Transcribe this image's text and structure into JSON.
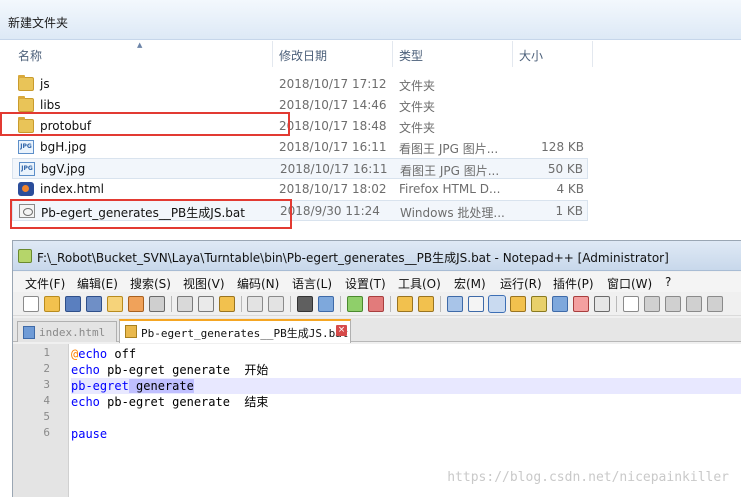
{
  "explorer": {
    "title": "新建文件夹",
    "columns": {
      "name": "名称",
      "date": "修改日期",
      "type": "类型",
      "size": "大小"
    },
    "rows": [
      {
        "name": "js",
        "date": "2018/10/17 17:12",
        "type": "文件夹",
        "size": "",
        "icon": "folder-icon"
      },
      {
        "name": "libs",
        "date": "2018/10/17 14:46",
        "type": "文件夹",
        "size": "",
        "icon": "folder-icon"
      },
      {
        "name": "protobuf",
        "date": "2018/10/17 18:48",
        "type": "文件夹",
        "size": "",
        "icon": "folder-icon"
      },
      {
        "name": "bgH.jpg",
        "date": "2018/10/17 16:11",
        "type": "看图王 JPG 图片...",
        "size": "128 KB",
        "icon": "jpg-file-icon"
      },
      {
        "name": "bgV.jpg",
        "date": "2018/10/17 16:11",
        "type": "看图王 JPG 图片...",
        "size": "50 KB",
        "icon": "jpg-file-icon"
      },
      {
        "name": "index.html",
        "date": "2018/10/17 18:02",
        "type": "Firefox HTML D...",
        "size": "4 KB",
        "icon": "html-file-icon"
      },
      {
        "name": "Pb-egert_generates__PB生成JS.bat",
        "date": "2018/9/30 11:24",
        "type": "Windows 批处理...",
        "size": "1 KB",
        "icon": "bat-file-icon"
      }
    ],
    "jpg_icon_text": "JPG"
  },
  "npp": {
    "title": "F:\\_Robot\\Bucket_SVN\\Laya\\Turntable\\bin\\Pb-egert_generates__PB生成JS.bat - Notepad++ [Administrator]",
    "menu": [
      "文件(F)",
      "编辑(E)",
      "搜索(S)",
      "视图(V)",
      "编码(N)",
      "语言(L)",
      "设置(T)",
      "工具(O)",
      "宏(M)",
      "运行(R)",
      "插件(P)",
      "窗口(W)",
      "?"
    ],
    "tabs": [
      {
        "label": "index.html",
        "active": false
      },
      {
        "label": "Pb-egert_generates__PB生成JS.bat",
        "active": true
      }
    ],
    "tab_close_glyph": "×",
    "lines": [
      {
        "num": "1",
        "parts": [
          {
            "t": "@",
            "c": "at"
          },
          {
            "t": "echo",
            "c": "kw"
          },
          {
            "t": " off",
            "c": "plain"
          }
        ]
      },
      {
        "num": "2",
        "parts": [
          {
            "t": "echo",
            "c": "kw"
          },
          {
            "t": " pb-egret generate  开始",
            "c": "plain"
          }
        ]
      },
      {
        "num": "3",
        "parts": [
          {
            "t": "pb-egret",
            "c": "kw"
          },
          {
            "t": " generate",
            "c": "plain sel-text"
          }
        ],
        "current": true
      },
      {
        "num": "4",
        "parts": [
          {
            "t": "echo",
            "c": "kw"
          },
          {
            "t": " pb-egret generate  结束",
            "c": "plain"
          }
        ]
      },
      {
        "num": "5",
        "parts": []
      },
      {
        "num": "6",
        "parts": [
          {
            "t": "pause",
            "c": "kw"
          }
        ]
      }
    ]
  },
  "watermark": "https://blog.csdn.net/nicepainkiller",
  "colors": {
    "highlight_box": "#e23a32",
    "keyword": "#0000ff",
    "at_sign": "#ff8000",
    "current_line": "#e8e8ff"
  }
}
